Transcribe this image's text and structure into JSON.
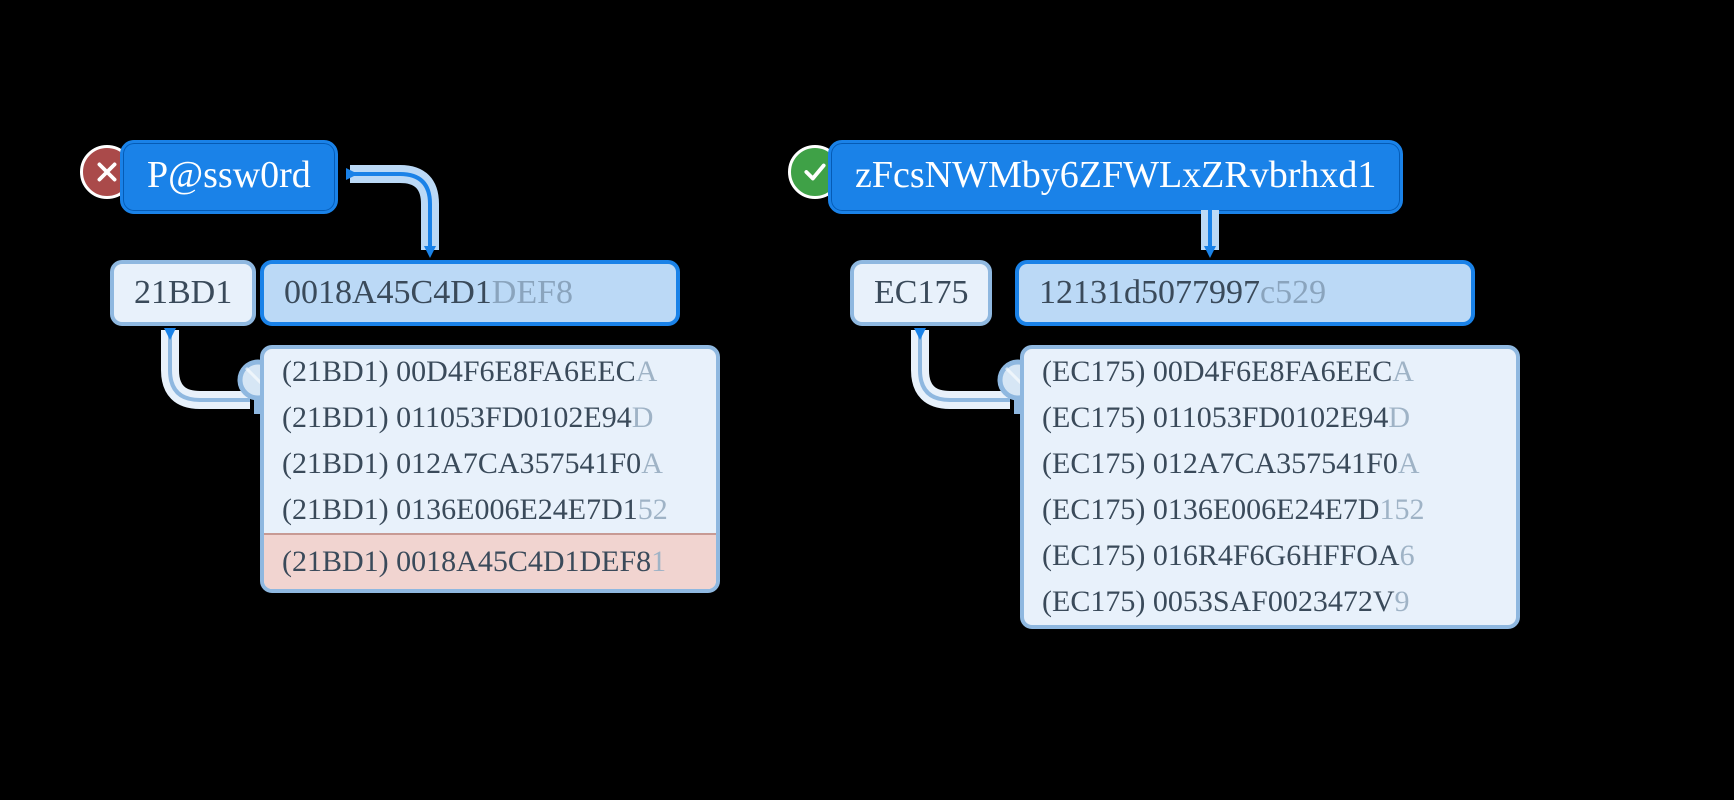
{
  "left": {
    "status": "fail",
    "password": "P@ssw0rd",
    "prefix": "21BD1",
    "hash_visible": "0018A45C4D1",
    "hash_faded": "DEF8",
    "results": [
      {
        "prefix": "21BD1",
        "mid": "00D4F6E8FA6EEC",
        "tail": "A"
      },
      {
        "prefix": "21BD1",
        "mid": "011053FD0102E94",
        "tail": "D"
      },
      {
        "prefix": "21BD1",
        "mid": "012A7CA357541F0",
        "tail": "A"
      },
      {
        "prefix": "21BD1",
        "mid": "0136E006E24E7D1",
        "tail": "52"
      }
    ],
    "match": {
      "prefix": "21BD1",
      "mid": "0018A45C4D1DEF8",
      "tail": "1"
    }
  },
  "right": {
    "status": "ok",
    "password": "zFcsNWMby6ZFWLxZRvbrhxd1",
    "prefix": "EC175",
    "hash_visible": "12131d5077997",
    "hash_faded": "c529",
    "results": [
      {
        "prefix": "EC175",
        "mid": "00D4F6E8FA6EEC",
        "tail": "A"
      },
      {
        "prefix": "EC175",
        "mid": "011053FD0102E94",
        "tail": "D"
      },
      {
        "prefix": "EC175",
        "mid": "012A7CA357541F0",
        "tail": "A"
      },
      {
        "prefix": "EC175",
        "mid": "0136E006E24E7D",
        "tail": "152"
      },
      {
        "prefix": "EC175",
        "mid": "016R4F6G6HFFOA",
        "tail": "6"
      },
      {
        "prefix": "EC175",
        "mid": "0053SAF0023472V",
        "tail": "9"
      }
    ]
  }
}
